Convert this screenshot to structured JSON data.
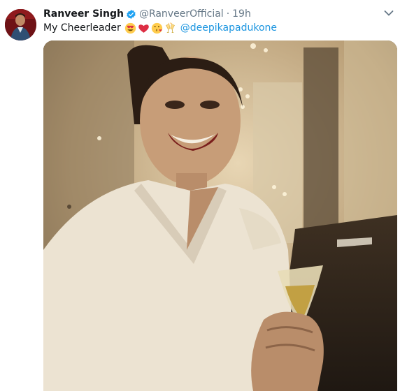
{
  "tweet": {
    "author_name": "Ranveer Singh",
    "handle": "@RanveerOfficial",
    "separator": "·",
    "time": "19h",
    "text": "My Cheerleader",
    "mention": "@deepikapadukone",
    "emojis": [
      "heart-eyes-emoji",
      "red-heart-emoji",
      "kissing-heart-emoji",
      "clinking-glasses-emoji"
    ]
  },
  "colors": {
    "link": "#1b95e0",
    "verified": "#1da1f2",
    "secondary_text": "#657786"
  }
}
